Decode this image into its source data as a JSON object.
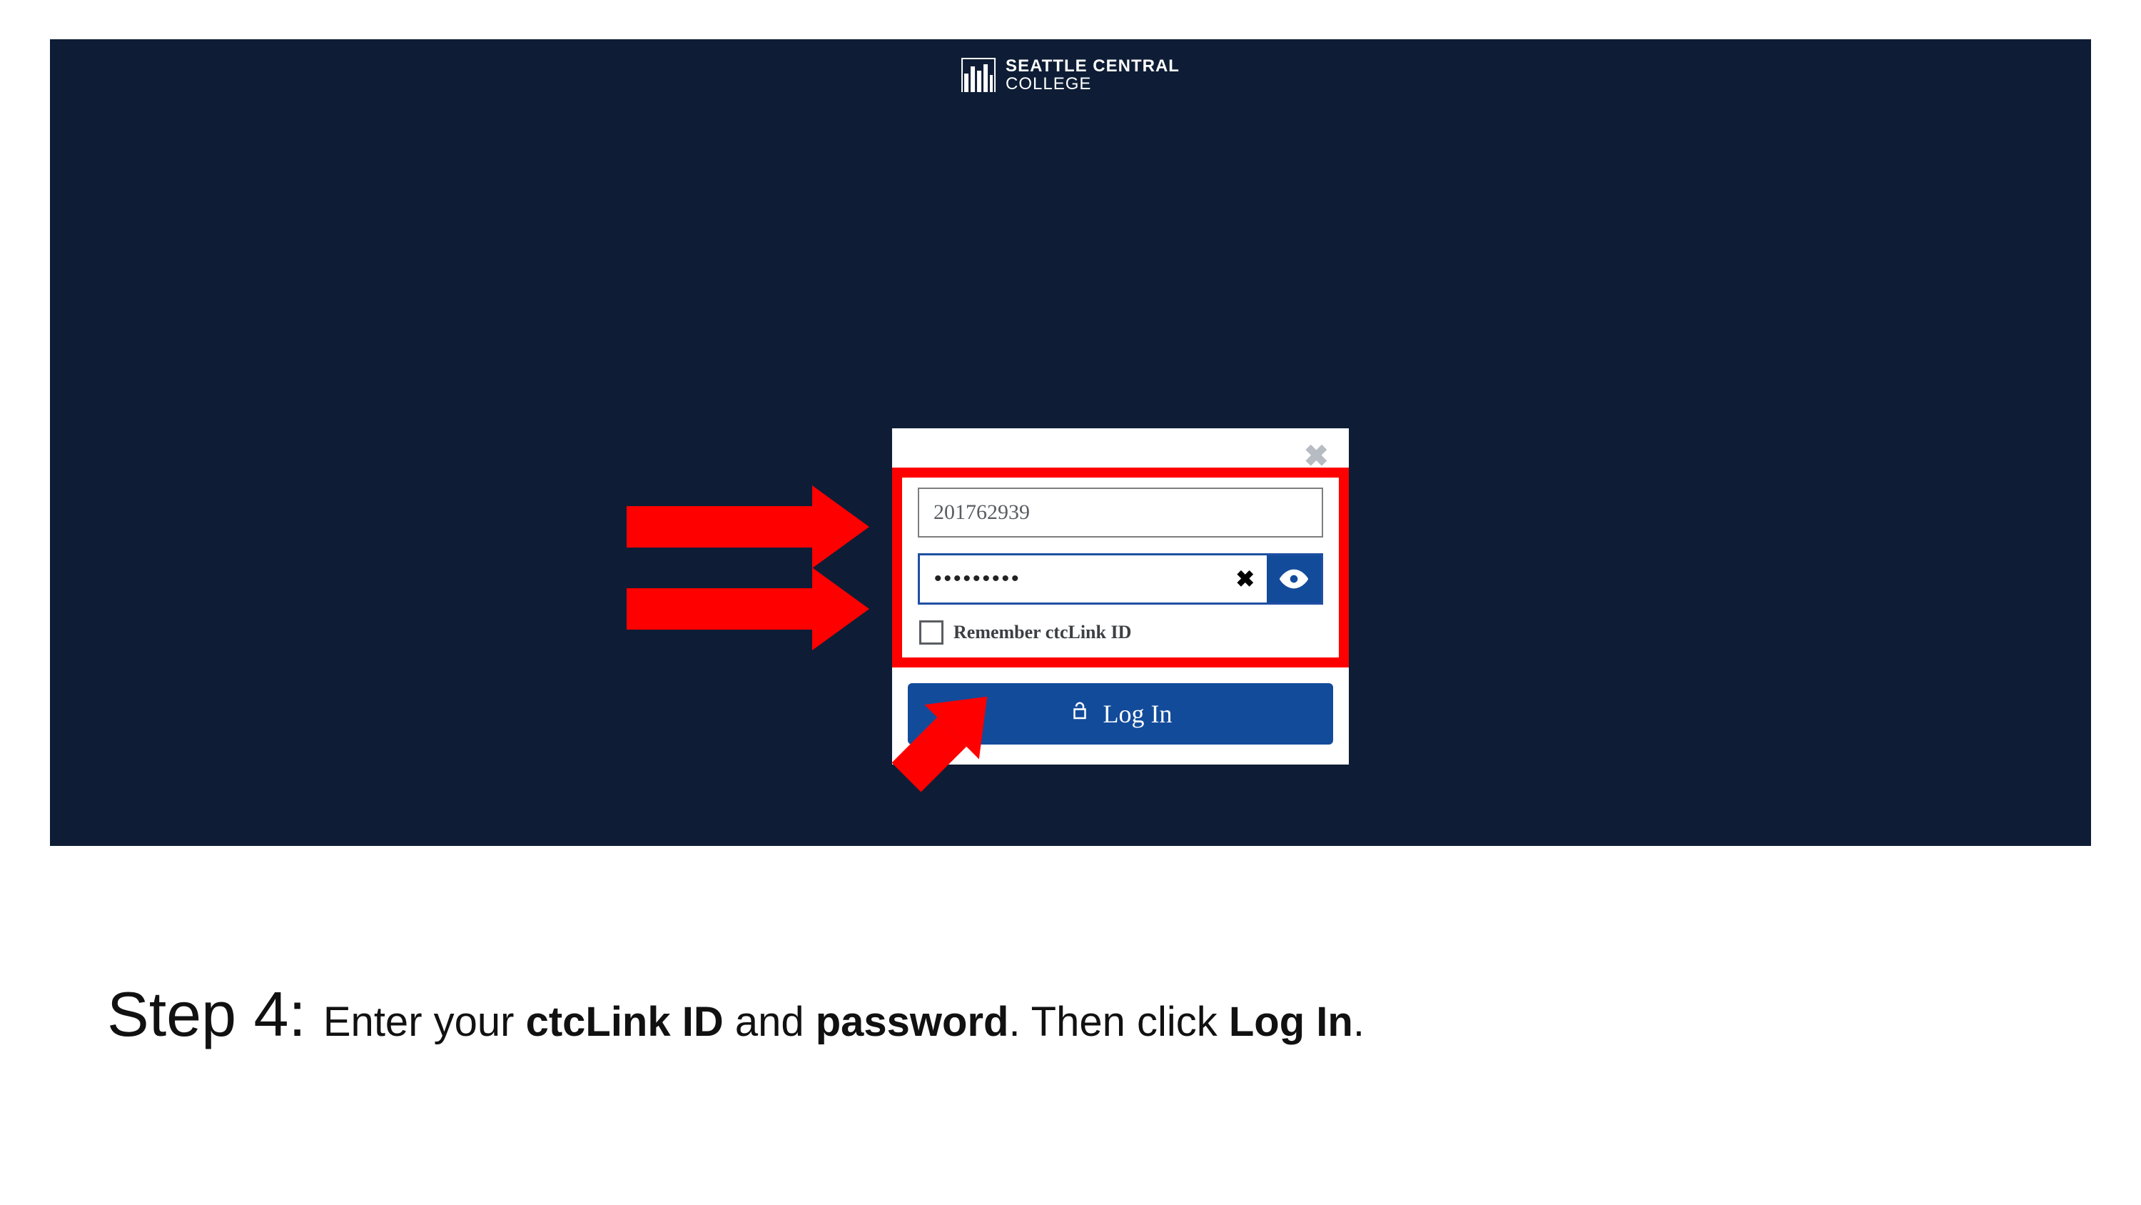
{
  "logo": {
    "line1": "SEATTLE CENTRAL",
    "line2": "COLLEGE"
  },
  "login": {
    "id_value": "201762939",
    "password_value": "•••••••••",
    "remember_label": "Remember ctcLink ID",
    "login_button": "Log In"
  },
  "caption": {
    "step_label": "Step 4:",
    "text_a": "Enter your ",
    "bold_a": "ctcLink ID",
    "text_b": " and ",
    "bold_b": "password",
    "text_c": ".  Then click ",
    "bold_c": "Log In",
    "text_d": "."
  }
}
